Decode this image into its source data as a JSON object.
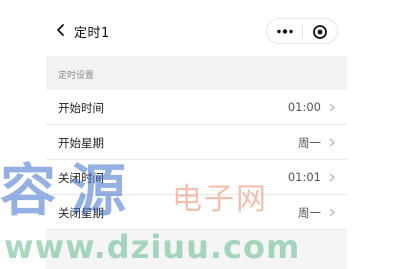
{
  "nav": {
    "title": "定时1"
  },
  "section": {
    "title": "定时设置"
  },
  "rows": [
    {
      "label": "开始时间",
      "value": "01:00"
    },
    {
      "label": "开始星期",
      "value": "周一"
    },
    {
      "label": "关闭时间",
      "value": "01:01"
    },
    {
      "label": "关闭星期",
      "value": "周一"
    }
  ],
  "watermark": {
    "big": "容源",
    "cn": "电子网",
    "url": "www.dziuu.com"
  },
  "icons": {
    "back": "chevron-left-icon",
    "more": "more-dots-icon",
    "close": "target-close-icon",
    "row_arrow": "chevron-right-icon"
  }
}
